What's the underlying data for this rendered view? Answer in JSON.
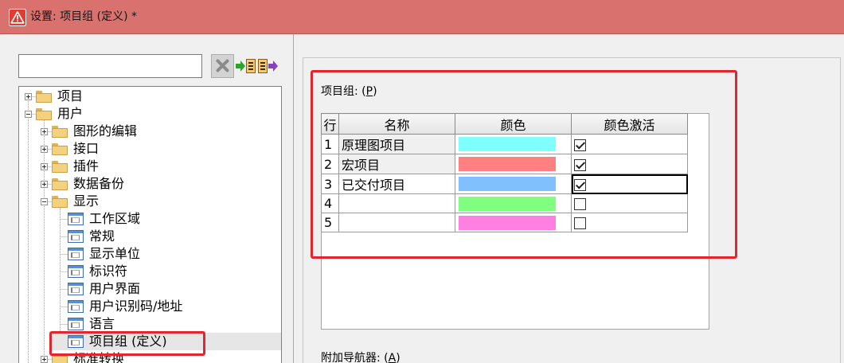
{
  "window": {
    "title": "设置: 项目组 (定义) *",
    "icon": "warning-triangle-icon"
  },
  "colors": {
    "titlebar": "#d9726e",
    "annotation": "#e3262e",
    "selection": "#e6e6e6"
  },
  "sidebar": {
    "search": {
      "value": ""
    },
    "toolbar": [
      {
        "icon": "clear-icon"
      },
      {
        "icon": "arrow-into-box-icon"
      },
      {
        "icon": "box-arrow-out-icon"
      }
    ],
    "tree": [
      {
        "label": "项目",
        "level": 0,
        "expanded": false
      },
      {
        "label": "用户",
        "level": 0,
        "expanded": true
      },
      {
        "label": "图形的编辑",
        "level": 1,
        "expanded": false
      },
      {
        "label": "接口",
        "level": 1,
        "expanded": false
      },
      {
        "label": "插件",
        "level": 1,
        "expanded": false
      },
      {
        "label": "数据备份",
        "level": 1,
        "expanded": false
      },
      {
        "label": "显示",
        "level": 1,
        "expanded": true
      },
      {
        "label": "工作区域",
        "level": 2
      },
      {
        "label": "常规",
        "level": 2
      },
      {
        "label": "显示单位",
        "level": 2
      },
      {
        "label": "标识符",
        "level": 2
      },
      {
        "label": "用户界面",
        "level": 2
      },
      {
        "label": "用户识别码/地址",
        "level": 2
      },
      {
        "label": "语言",
        "level": 2
      },
      {
        "label": "项目组 (定义)",
        "level": 2,
        "selected": true
      },
      {
        "label": "标准转换",
        "level": 1,
        "expanded": false
      }
    ]
  },
  "main": {
    "group": {
      "label_prefix": "项目组: (",
      "access_key": "P",
      "label_suffix": ")"
    },
    "table": {
      "headers": [
        "行",
        "名称",
        "颜色",
        "颜色激活"
      ],
      "rows": [
        {
          "row": "1",
          "name": "原理图项目",
          "color": "#80ffff",
          "active": true
        },
        {
          "row": "2",
          "name": "宏项目",
          "color": "#ff8080",
          "active": true
        },
        {
          "row": "3",
          "name": "已交付项目",
          "color": "#80c0ff",
          "active": true
        },
        {
          "row": "4",
          "name": "",
          "color": "#80ff80",
          "active": false
        },
        {
          "row": "5",
          "name": "",
          "color": "#ff80e0",
          "active": false
        }
      ]
    },
    "navigator": {
      "label_prefix": "附加导航器: (",
      "access_key": "A",
      "label_suffix": ")"
    }
  }
}
